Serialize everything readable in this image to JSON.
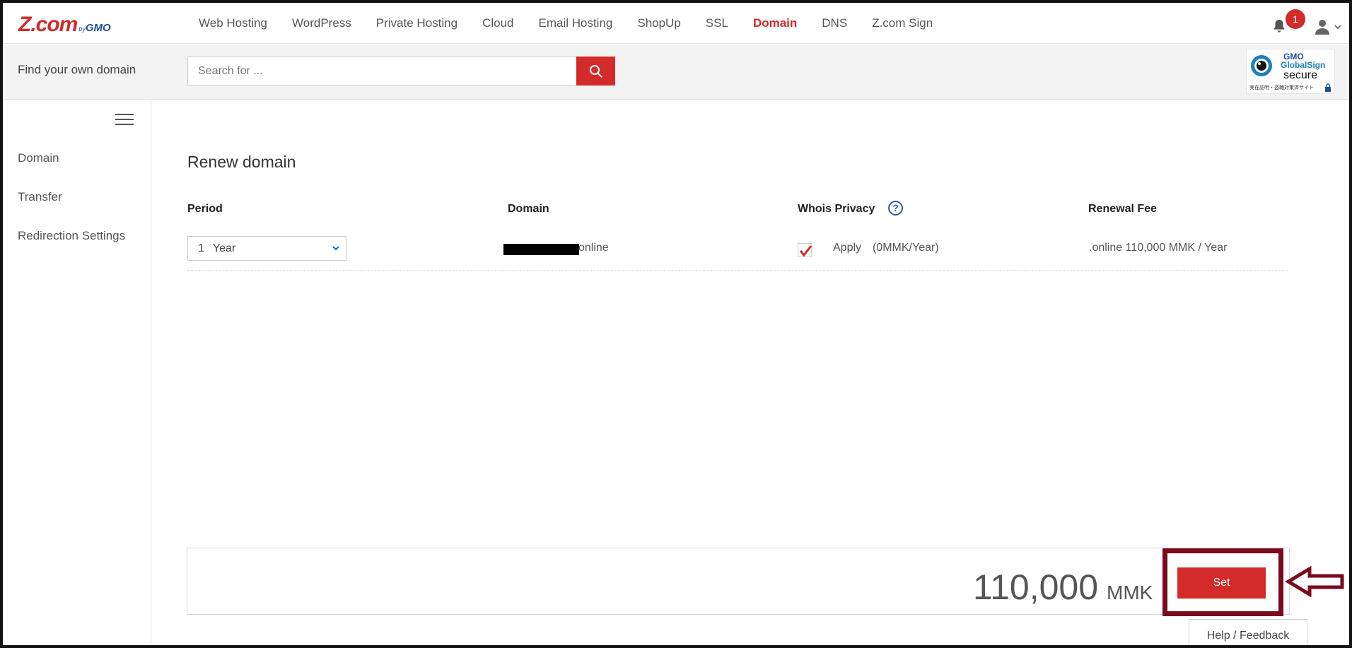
{
  "logo": {
    "main": "Z.com",
    "by": "by",
    "gmo": "GMO"
  },
  "nav": {
    "items": [
      {
        "label": "Web Hosting"
      },
      {
        "label": "WordPress"
      },
      {
        "label": "Private Hosting"
      },
      {
        "label": "Cloud"
      },
      {
        "label": "Email Hosting"
      },
      {
        "label": "ShopUp"
      },
      {
        "label": "SSL"
      },
      {
        "label": "Domain",
        "active": true
      },
      {
        "label": "DNS"
      },
      {
        "label": "Z.com Sign"
      }
    ],
    "notification_count": "1",
    "icons": [
      "bell-icon",
      "user-icon",
      "chevron-down-icon"
    ]
  },
  "search": {
    "label": "Find your own domain",
    "placeholder": "Search for ...",
    "button_icon": "search-icon"
  },
  "secure_badge": {
    "gmo": "GMO",
    "brand": "GlobalSign",
    "word": "secure",
    "jp": "実在証明・盗聴対策済サイト"
  },
  "sidebar": {
    "items": [
      {
        "label": "Domain"
      },
      {
        "label": "Transfer"
      },
      {
        "label": "Redirection Settings"
      }
    ]
  },
  "main": {
    "title": "Renew domain",
    "columns": {
      "period": "Period",
      "domain": "Domain",
      "whois": "Whois Privacy",
      "fee": "Renewal Fee"
    },
    "row": {
      "period_value": "1",
      "period_unit": "Year",
      "domain_suffix": "online",
      "whois_checked": true,
      "apply_label": "Apply",
      "apply_price": "(0MMK/Year)",
      "renewal_fee": ".online 110,000 MMK / Year"
    }
  },
  "total": {
    "amount": "110,000",
    "currency": "MMK",
    "set_label": "Set"
  },
  "footer": {
    "help_feedback": "Help / Feedback"
  },
  "colors": {
    "brand_red": "#d32a2a",
    "highlight": "#7b0a1e",
    "link_blue": "#2a5db0"
  }
}
